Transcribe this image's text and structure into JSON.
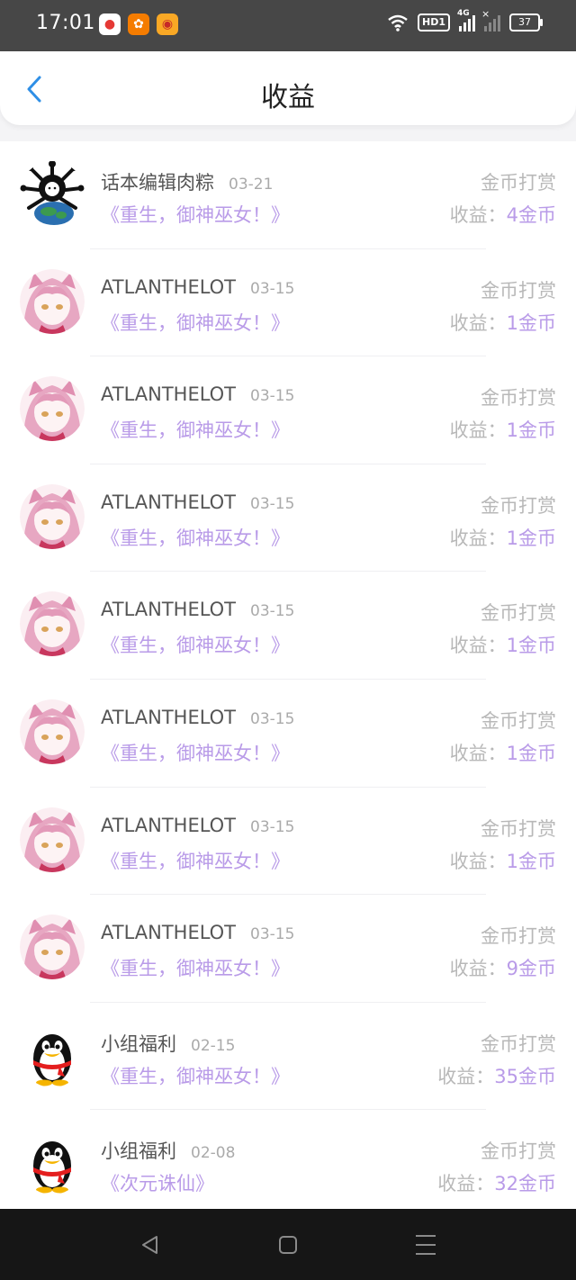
{
  "status_bar": {
    "time": "17:01",
    "hd_label": "HD1",
    "network_label": "4G",
    "battery": "37"
  },
  "header": {
    "title": "收益"
  },
  "items": [
    {
      "name": "话本编辑肉粽",
      "date": "03-21",
      "book": "《重生，御神巫女！》",
      "type": "金币打赏",
      "earnings_label": "收益：",
      "amount": "4金币",
      "avatar": "editor"
    },
    {
      "name": "ATLANTHELOT",
      "date": "03-15",
      "book": "《重生，御神巫女！》",
      "type": "金币打赏",
      "earnings_label": "收益：",
      "amount": "1金币",
      "avatar": "anime"
    },
    {
      "name": "ATLANTHELOT",
      "date": "03-15",
      "book": "《重生，御神巫女！》",
      "type": "金币打赏",
      "earnings_label": "收益：",
      "amount": "1金币",
      "avatar": "anime"
    },
    {
      "name": "ATLANTHELOT",
      "date": "03-15",
      "book": "《重生，御神巫女！》",
      "type": "金币打赏",
      "earnings_label": "收益：",
      "amount": "1金币",
      "avatar": "anime"
    },
    {
      "name": "ATLANTHELOT",
      "date": "03-15",
      "book": "《重生，御神巫女！》",
      "type": "金币打赏",
      "earnings_label": "收益：",
      "amount": "1金币",
      "avatar": "anime"
    },
    {
      "name": "ATLANTHELOT",
      "date": "03-15",
      "book": "《重生，御神巫女！》",
      "type": "金币打赏",
      "earnings_label": "收益：",
      "amount": "1金币",
      "avatar": "anime"
    },
    {
      "name": "ATLANTHELOT",
      "date": "03-15",
      "book": "《重生，御神巫女！》",
      "type": "金币打赏",
      "earnings_label": "收益：",
      "amount": "1金币",
      "avatar": "anime"
    },
    {
      "name": "ATLANTHELOT",
      "date": "03-15",
      "book": "《重生，御神巫女！》",
      "type": "金币打赏",
      "earnings_label": "收益：",
      "amount": "9金币",
      "avatar": "anime"
    },
    {
      "name": "小组福利",
      "date": "02-15",
      "book": "《重生，御神巫女！》",
      "type": "金币打赏",
      "earnings_label": "收益：",
      "amount": "35金币",
      "avatar": "penguin"
    },
    {
      "name": "小组福利",
      "date": "02-08",
      "book": "《次元诛仙》",
      "type": "金币打赏",
      "earnings_label": "收益：",
      "amount": "32金币",
      "avatar": "penguin"
    }
  ],
  "colors": {
    "accent": "#b99be8",
    "back_arrow": "#2f8fe6",
    "muted_text": "#b8b8b8"
  }
}
